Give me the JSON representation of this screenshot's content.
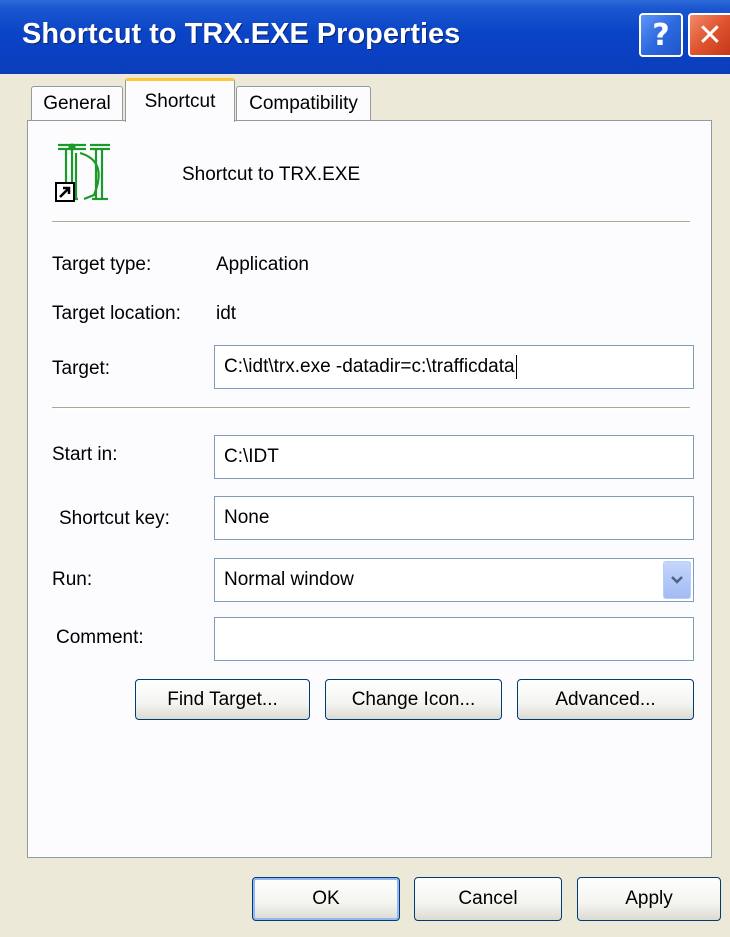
{
  "window": {
    "title": "Shortcut to TRX.EXE Properties",
    "help_symbol": "?",
    "close_symbol": "✕"
  },
  "tabs": [
    {
      "label": "General"
    },
    {
      "label": "Shortcut"
    },
    {
      "label": "Compatibility"
    }
  ],
  "shortcut": {
    "name": "Shortcut to TRX.EXE",
    "target_type_label": "Target type:",
    "target_type_value": "Application",
    "target_location_label": "Target location:",
    "target_location_value": "idt",
    "target_label": "Target:",
    "target_value": "C:\\idt\\trx.exe -datadir=c:\\trafficdata",
    "start_in_label": "Start in:",
    "start_in_value": "C:\\IDT",
    "shortcut_key_label": "Shortcut key:",
    "shortcut_key_value": "None",
    "run_label": "Run:",
    "run_value": "Normal window",
    "comment_label": "Comment:",
    "comment_value": ""
  },
  "actions": {
    "find_target": "Find Target...",
    "change_icon": "Change Icon...",
    "advanced": "Advanced..."
  },
  "footer": {
    "ok": "OK",
    "cancel": "Cancel",
    "apply": "Apply"
  },
  "colors": {
    "titlebar": "#0a44c6",
    "tab_highlight": "#ffc83c",
    "dialog_bg": "#ece9d8",
    "panel_bg": "#fcfcfe",
    "icon_green": "#1a9a2a"
  }
}
